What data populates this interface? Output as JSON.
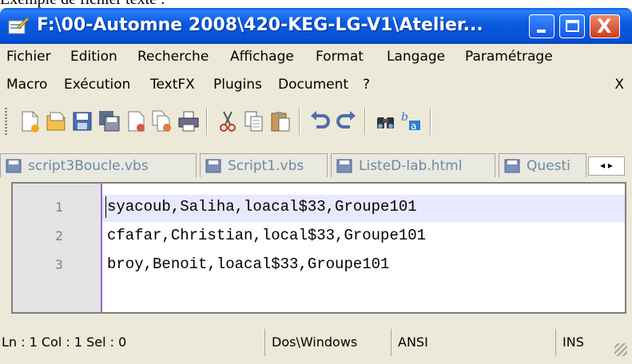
{
  "caption": "Exemple de fichier texte :",
  "window": {
    "title": "F:\\00-Automne 2008\\420-KEG-LG-V1\\Atelier...",
    "controls": {
      "minimize": "minimize",
      "maximize": "maximize",
      "close": "X"
    }
  },
  "menu_row1": [
    "Fichier",
    "Edition",
    "Recherche",
    "Affichage",
    "Format",
    "Langage",
    "Paramétrage"
  ],
  "menu_row2": [
    "Macro",
    "Exécution",
    "TextFX",
    "Plugins",
    "Document",
    "?"
  ],
  "menu_close": "X",
  "toolbar": {
    "icons": [
      "new-file-icon",
      "open-file-icon",
      "save-icon",
      "save-all-icon",
      "close-file-icon",
      "close-all-icon",
      "print-icon",
      "cut-icon",
      "copy-icon",
      "paste-icon",
      "undo-icon",
      "redo-icon",
      "find-icon",
      "replace-icon"
    ]
  },
  "tabs": [
    "script3Boucle.vbs",
    "Script1.vbs",
    "ListeD-lab.html",
    "Questi"
  ],
  "tab_arrows": "◂ ▸",
  "editor": {
    "line_numbers": [
      "1",
      "2",
      "3"
    ],
    "lines": [
      "syacoub,Saliha,loacal$33,Groupe101",
      "cfafar,Christian,local$33,Groupe101",
      "broy,Benoit,loacal$33,Groupe101"
    ]
  },
  "status": {
    "position": "Ln : 1    Col : 1    Sel : 0",
    "eol": "Dos\\Windows",
    "encoding": "ANSI",
    "mode": "INS"
  },
  "colors": {
    "titlebar": "#0551d8",
    "chrome": "#ece9d8",
    "current_line": "#e8e8ff",
    "gutter": "#e3e3e3"
  }
}
